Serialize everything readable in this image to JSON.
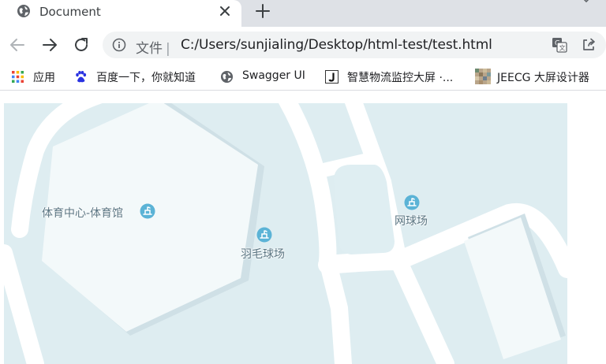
{
  "browser": {
    "tab": {
      "title": "Document"
    },
    "address_bar": {
      "scheme_label": "文件",
      "separator": "|",
      "url": "C:/Users/sunjialing/Desktop/html-test/test.html"
    },
    "bookmarks": [
      {
        "label": "应用",
        "icon": "apps-grid-icon"
      },
      {
        "label": "百度一下，你就知道",
        "icon": "baidu-paw-icon"
      },
      {
        "label": "Swagger UI",
        "icon": "globe-icon"
      },
      {
        "label": "智慧物流监控大屏 ·...",
        "icon": "j-logo-icon"
      },
      {
        "label": "JEECG 大屏设计器",
        "icon": "mosaic-thumbnail-icon"
      }
    ]
  },
  "map": {
    "pois": [
      {
        "label": "体育中心-体育馆",
        "icon": "sports-venue-icon"
      },
      {
        "label": "羽毛球场",
        "icon": "sports-venue-icon"
      },
      {
        "label": "网球场",
        "icon": "sports-venue-icon"
      }
    ],
    "colors": {
      "background": "#deedf1",
      "road": "#ffffff",
      "building": "#f3f9fa",
      "building_shadow": "#cfe0e6",
      "poi_icon": "#5bb3d6",
      "poi_text": "#5a7582"
    }
  }
}
